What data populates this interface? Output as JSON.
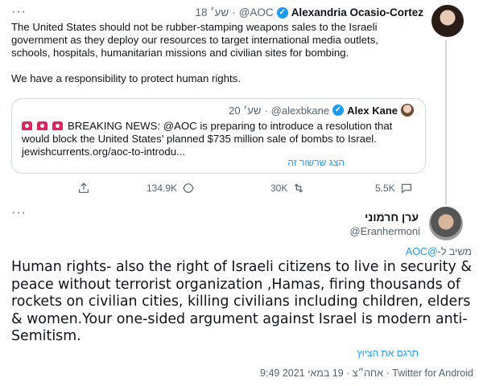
{
  "tweet1": {
    "name": "Alexandria Ocasio-Cortez",
    "handle": "@AOC",
    "separator": "·",
    "time": "18 שע׳",
    "body_lines": [
      "The United States should not be rubber-stamping weapons sales to the Israeli government as they deploy our resources to target international media outlets, schools, hospitals, humanitarian missions and civilian sites for bombing.",
      "We have a responsibility to protect human rights."
    ],
    "more": "···",
    "quote": {
      "name": "Alex Kane",
      "handle": "@alexbkane",
      "separator": "·",
      "time": "20 שע׳",
      "text": "BREAKING NEWS: @AOC is preparing to introduce a resolution that would block the United States' planned $735 million sale of bombs to Israel. jewishcurrents.org/aoc-to-introdu...",
      "show_thread": "הצג שרשור זה"
    },
    "actions": {
      "views": "134.9K",
      "retweets": "30K",
      "likes": "5.5K"
    }
  },
  "tweet2": {
    "more": "···",
    "name": "ערן חרמוני",
    "handle": "@Eranhermoni",
    "reply_prefix": "משיב ל-",
    "reply_handle": "@AOC",
    "body": "Human rights- also the right of Israeli citizens to live in security & peace without terrorist organization ,Hamas, firing thousands of rockets on civilian cities, killing civilians including children, elders & women.Your one-sided argument against Israel is modern anti-Semitism.",
    "translate": "תרגם את הציוץ",
    "meta": "9:49 אחה״צ · 19 במאי 2021 · Twitter for Android"
  },
  "colors": {
    "accent": "#1d9bf0",
    "text": "#0f1419",
    "muted": "#536471",
    "border": "#cfd9de",
    "siren": "#e0245e"
  },
  "icons": [
    "more-icon",
    "verified-icon",
    "siren-icon",
    "share-icon",
    "views-icon",
    "retweet-icon",
    "like-icon"
  ]
}
